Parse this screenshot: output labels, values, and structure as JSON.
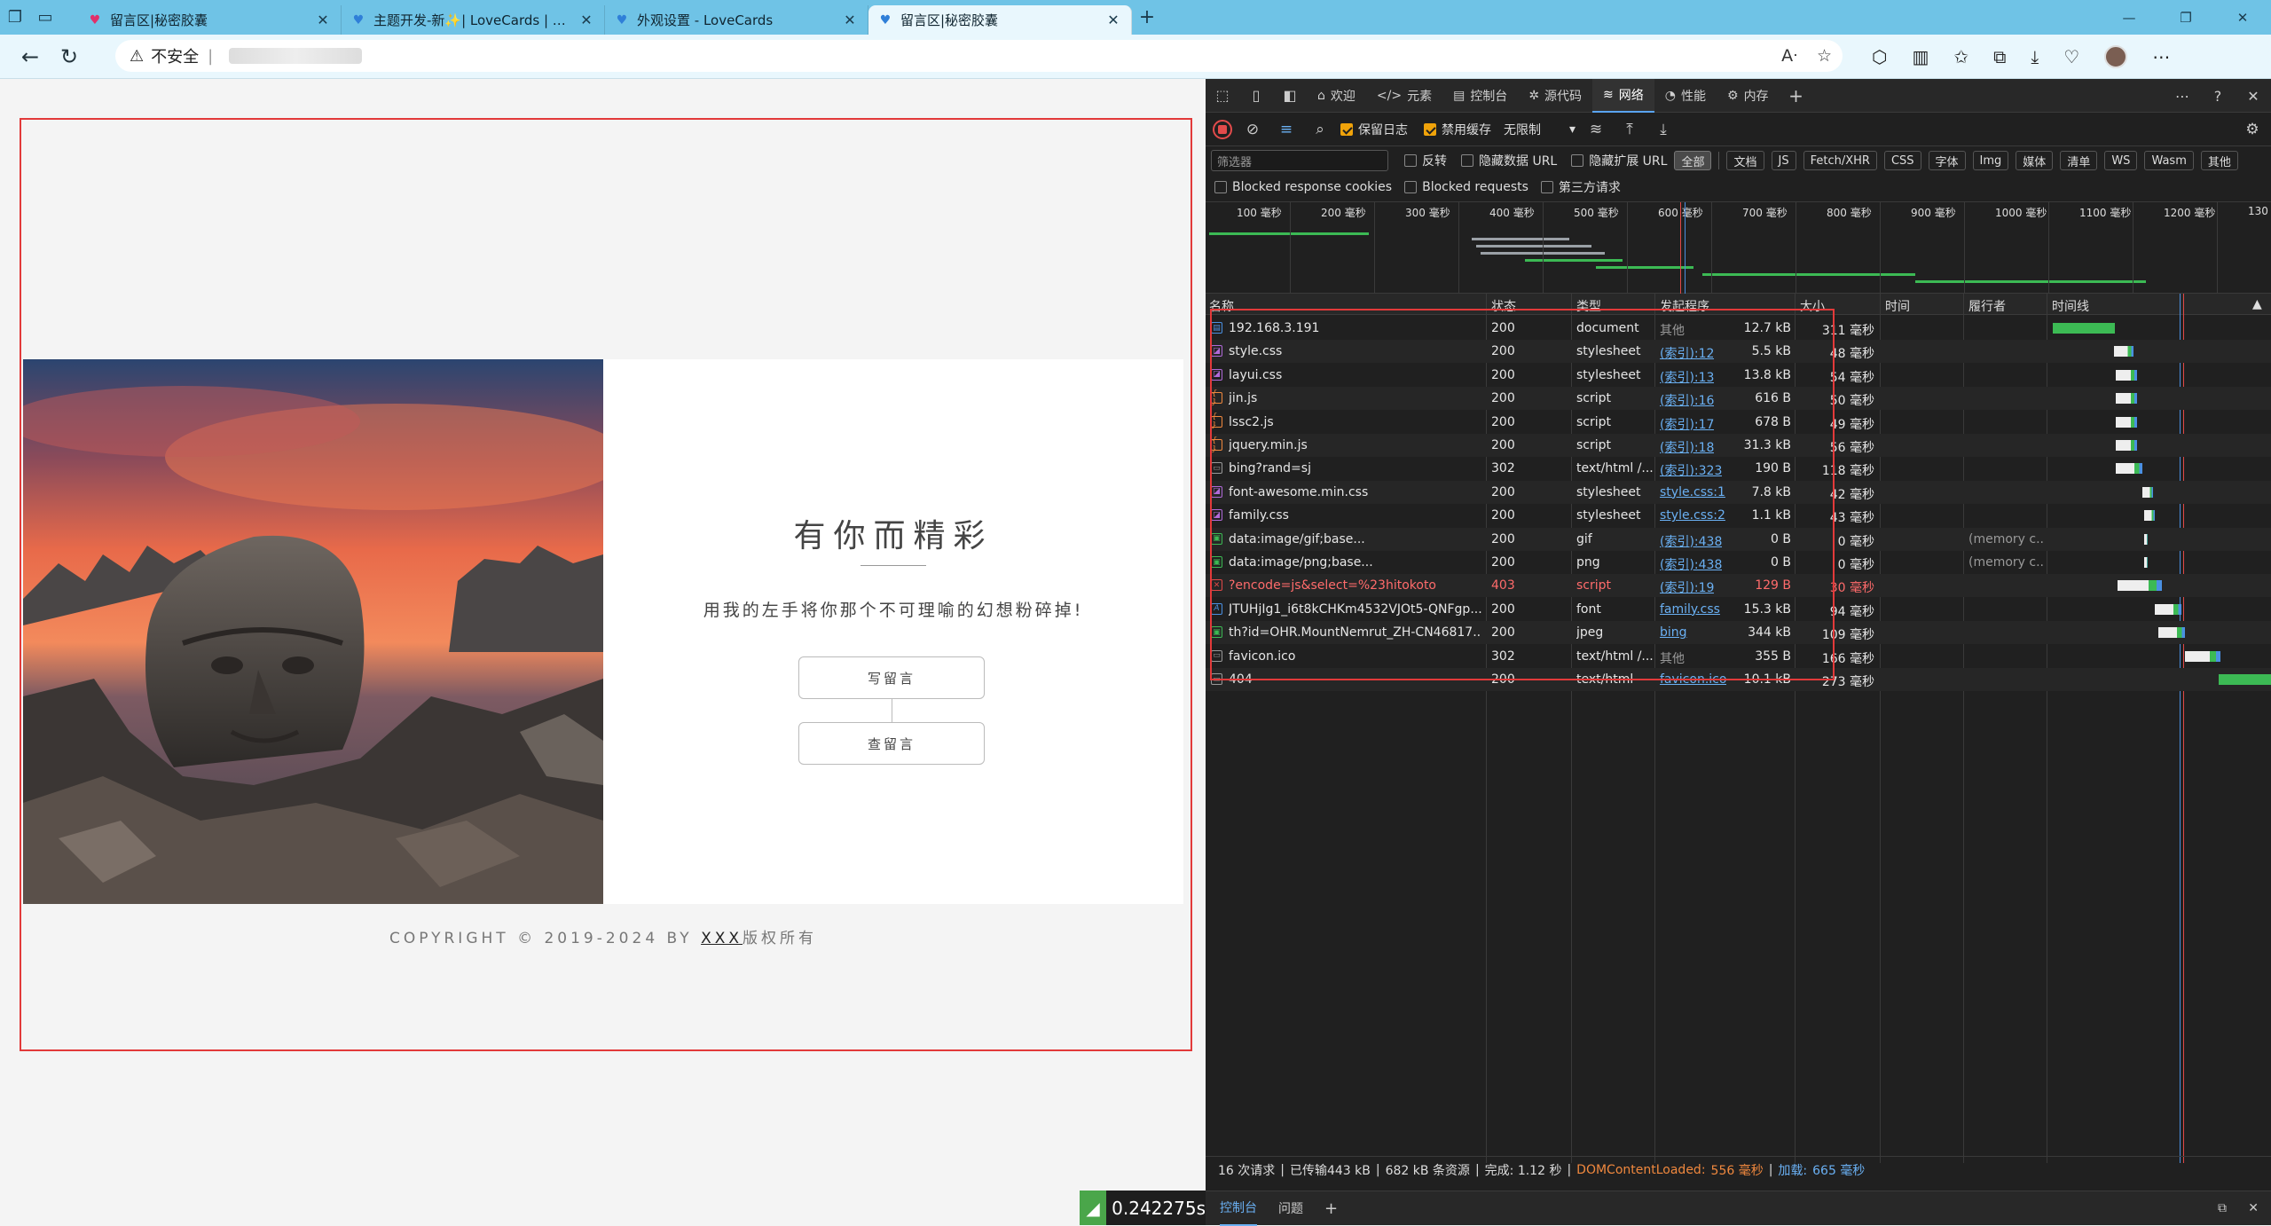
{
  "tabs": [
    {
      "title": "留言区|秘密胶囊",
      "active": false
    },
    {
      "title": "主题开发-新✨| LoveCards | 文档",
      "active": false
    },
    {
      "title": "外观设置 - LoveCards",
      "active": false
    },
    {
      "title": "留言区|秘密胶囊",
      "active": true
    }
  ],
  "address": {
    "security": "不安全"
  },
  "page": {
    "title": "有你而精彩",
    "subtitle": "用我的左手将你那个不可理喻的幻想粉碎掉!",
    "btn_write": "写留言",
    "btn_view": "查留言",
    "copyright_pre": "COPYRIGHT © 2019-2024 BY ",
    "copyright_name": "XXX",
    "copyright_post": "版权所有"
  },
  "fps": "0.242275s",
  "devtools": {
    "tabs": [
      "欢迎",
      "元素",
      "控制台",
      "源代码",
      "网络",
      "性能",
      "内存"
    ],
    "toolbar": {
      "preserve_log": "保留日志",
      "disable_cache": "禁用缓存",
      "throttle": "无限制"
    },
    "filter": {
      "placeholder": "筛选器",
      "invert": "反转",
      "hide_data": "隐藏数据 URL",
      "hide_ext": "隐藏扩展 URL",
      "chips": [
        "全部",
        "文档",
        "JS",
        "Fetch/XHR",
        "CSS",
        "字体",
        "Img",
        "媒体",
        "清单",
        "WS",
        "Wasm",
        "其他"
      ],
      "blocked_cookies": "Blocked response cookies",
      "blocked_requests": "Blocked requests",
      "third_party": "第三方请求"
    },
    "ticks": [
      "100 毫秒",
      "200 毫秒",
      "300 毫秒",
      "400 毫秒",
      "500 毫秒",
      "600 毫秒",
      "700 毫秒",
      "800 毫秒",
      "900 毫秒",
      "1000 毫秒",
      "1100 毫秒",
      "1200 毫秒",
      "130"
    ],
    "columns": [
      "名称",
      "状态",
      "类型",
      "发起程序",
      "大小",
      "时间",
      "履行者",
      "时间线"
    ],
    "rows": [
      {
        "name": "192.168.3.191",
        "status": "200",
        "type": "document",
        "initiator": "其他",
        "size": "12.7 kB",
        "time": "311 毫秒",
        "fulfilled": "",
        "icon": "doc"
      },
      {
        "name": "style.css",
        "status": "200",
        "type": "stylesheet",
        "initiator": "(索引):12",
        "size": "5.5 kB",
        "time": "48 毫秒",
        "fulfilled": "",
        "icon": "css"
      },
      {
        "name": "layui.css",
        "status": "200",
        "type": "stylesheet",
        "initiator": "(索引):13",
        "size": "13.8 kB",
        "time": "54 毫秒",
        "fulfilled": "",
        "icon": "css"
      },
      {
        "name": "jin.js",
        "status": "200",
        "type": "script",
        "initiator": "(索引):16",
        "size": "616 B",
        "time": "50 毫秒",
        "fulfilled": "",
        "icon": "js"
      },
      {
        "name": "lssc2.js",
        "status": "200",
        "type": "script",
        "initiator": "(索引):17",
        "size": "678 B",
        "time": "49 毫秒",
        "fulfilled": "",
        "icon": "js"
      },
      {
        "name": "jquery.min.js",
        "status": "200",
        "type": "script",
        "initiator": "(索引):18",
        "size": "31.3 kB",
        "time": "56 毫秒",
        "fulfilled": "",
        "icon": "js"
      },
      {
        "name": "bing?rand=sj",
        "status": "302",
        "type": "text/html /...",
        "initiator": "(索引):323",
        "size": "190 B",
        "time": "118 毫秒",
        "fulfilled": "",
        "icon": "other"
      },
      {
        "name": "font-awesome.min.css",
        "status": "200",
        "type": "stylesheet",
        "initiator": "style.css:1",
        "size": "7.8 kB",
        "time": "42 毫秒",
        "fulfilled": "",
        "icon": "css"
      },
      {
        "name": "family.css",
        "status": "200",
        "type": "stylesheet",
        "initiator": "style.css:2",
        "size": "1.1 kB",
        "time": "43 毫秒",
        "fulfilled": "",
        "icon": "css"
      },
      {
        "name": "data:image/gif;base...",
        "status": "200",
        "type": "gif",
        "initiator": "(索引):438",
        "size": "0 B",
        "time": "0 毫秒",
        "fulfilled": "(memory c...",
        "icon": "img"
      },
      {
        "name": "data:image/png;base...",
        "status": "200",
        "type": "png",
        "initiator": "(索引):438",
        "size": "0 B",
        "time": "0 毫秒",
        "fulfilled": "(memory c...",
        "icon": "img"
      },
      {
        "name": "?encode=js&select=%23hitokoto",
        "status": "403",
        "type": "script",
        "initiator": "(索引):19",
        "size": "129 B",
        "time": "30 毫秒",
        "fulfilled": "",
        "icon": "err"
      },
      {
        "name": "JTUHjIg1_i6t8kCHKm4532VJOt5-QNFgp...",
        "status": "200",
        "type": "font",
        "initiator": "family.css",
        "size": "15.3 kB",
        "time": "94 毫秒",
        "fulfilled": "",
        "icon": "font"
      },
      {
        "name": "th?id=OHR.MountNemrut_ZH-CN46817...",
        "status": "200",
        "type": "jpeg",
        "initiator": "bing",
        "size": "344 kB",
        "time": "109 毫秒",
        "fulfilled": "",
        "icon": "img"
      },
      {
        "name": "favicon.ico",
        "status": "302",
        "type": "text/html /...",
        "initiator": "其他",
        "size": "355 B",
        "time": "166 毫秒",
        "fulfilled": "",
        "icon": "other"
      },
      {
        "name": "404",
        "status": "200",
        "type": "text/html",
        "initiator": "favicon.ico",
        "size": "10.1 kB",
        "time": "273 毫秒",
        "fulfilled": "",
        "icon": "other"
      }
    ],
    "status": {
      "requests": "16 次请求",
      "transferred": "已传输443 kB",
      "resources": "682 kB 条资源",
      "finish": "完成: 1.12 秒",
      "dcl_label": "DOMContentLoaded:",
      "dcl_value": "556 毫秒",
      "load_label": "加载:",
      "load_value": "665 毫秒"
    },
    "drawer": [
      "控制台",
      "问题"
    ]
  }
}
